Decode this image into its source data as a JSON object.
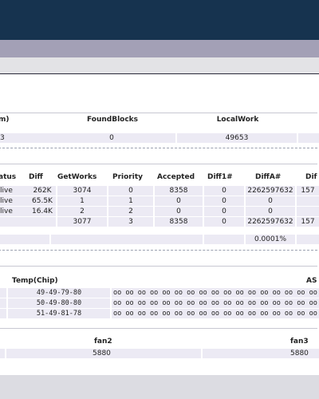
{
  "summary": {
    "headers": [
      "m)",
      "FoundBlocks",
      "LocalWork"
    ],
    "values": [
      "3",
      "0",
      "49653"
    ]
  },
  "pools": {
    "headers": [
      "atus",
      "Diff",
      "GetWorks",
      "Priority",
      "Accepted",
      "Diff1#",
      "DiffA#",
      "Dif"
    ],
    "rows": [
      [
        "live",
        "262K",
        "3074",
        "0",
        "8358",
        "0",
        "2262597632",
        "157"
      ],
      [
        "live",
        "65.5K",
        "1",
        "1",
        "0",
        "0",
        "0",
        ""
      ],
      [
        "live",
        "16.4K",
        "2",
        "2",
        "0",
        "0",
        "0",
        ""
      ],
      [
        "",
        "",
        "3077",
        "3",
        "8358",
        "0",
        "2262597632",
        "157"
      ]
    ],
    "extra_row": [
      "0.0001%"
    ]
  },
  "chips": {
    "headers": [
      "Temp(Chip)",
      "AS"
    ],
    "rows": [
      [
        "49-49-79-80",
        "oo oo oo oo oo oo oo oo oo oo oo oo oo oo oo oo oo oo oo oo oo oo oo oo"
      ],
      [
        "50-49-80-80",
        "oo oo oo oo oo oo oo oo oo oo oo oo oo oo oo oo oo oo oo oo oo oo oo oo"
      ],
      [
        "51-49-81-78",
        "oo oo oo oo oo oo oo oo oo oo oo oo oo oo oo oo oo oo oo oo oo oo oo oo"
      ]
    ]
  },
  "fans": {
    "headers": [
      "fan2",
      "fan3"
    ],
    "values": [
      "5880",
      "5880"
    ]
  }
}
